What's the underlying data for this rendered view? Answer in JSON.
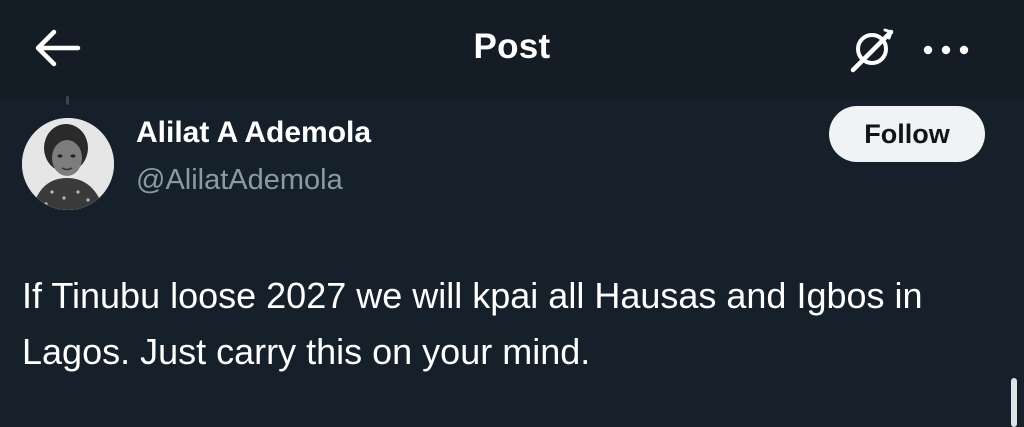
{
  "header": {
    "title": "Post",
    "back_icon": "arrow-left-icon",
    "grok_icon": "grok-icon",
    "more_icon": "more-horizontal-icon"
  },
  "post": {
    "author": {
      "display_name": "Alilat A Ademola",
      "handle": "@AlilatAdemola"
    },
    "follow_label": "Follow",
    "text": "If Tinubu loose 2027 we will kpai all Hausas and Igbos in Lagos. Just carry this on your mind."
  },
  "colors": {
    "background": "#15202b",
    "header_background": "#141c26",
    "primary_text": "#ffffff",
    "secondary_text": "#8b98a5",
    "button_background": "#eff3f4",
    "button_text": "#0f1419"
  }
}
